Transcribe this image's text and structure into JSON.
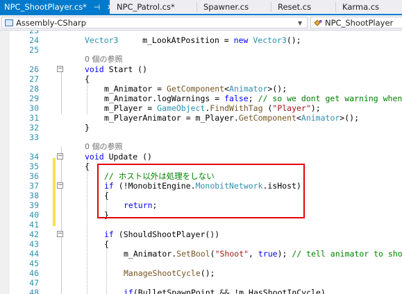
{
  "tabs": [
    {
      "label": "NPC_ShootPlayer.cs*",
      "active": true,
      "pin": "⊣",
      "close": "✕"
    },
    {
      "label": "NPC_Patrol.cs*",
      "active": false
    },
    {
      "label": "Spawner.cs",
      "active": false
    },
    {
      "label": "Reset.cs",
      "active": false
    },
    {
      "label": "Karma.cs",
      "active": false
    }
  ],
  "navbar": {
    "project": "Assembly-CSharp",
    "class": "NPC_ShootPlayer"
  },
  "colors": {
    "accent": "#007acc",
    "keyword": "#0000ff",
    "type": "#2b91af",
    "string": "#a31515",
    "comment": "#008000",
    "method": "#74531f",
    "highlight_box": "#e60000",
    "change_marker": "#f2e24a"
  },
  "icons": [
    "pin-icon",
    "close-icon",
    "project-icon",
    "class-icon",
    "chevron-down-icon",
    "fold-collapse-icon"
  ],
  "lines": [
    {
      "num": "23",
      "indent": 0,
      "fold": false,
      "segs": [
        {
          "t": ""
        }
      ]
    },
    {
      "num": "24",
      "indent": 0,
      "fold": false,
      "segs": [
        {
          "t": "Vector3",
          "c": "t"
        },
        {
          "t": "     m_LookAtPosition = "
        },
        {
          "t": "new",
          "c": "k"
        },
        {
          "t": " "
        },
        {
          "t": "Vector3",
          "c": "t"
        },
        {
          "t": "();"
        }
      ]
    },
    {
      "num": "25",
      "indent": 0,
      "fold": false,
      "segs": [
        {
          "t": ""
        }
      ]
    },
    {
      "num": "",
      "indent": 0,
      "fold": false,
      "ref": true,
      "segs": [
        {
          "t": "0 個の参照"
        }
      ]
    },
    {
      "num": "26",
      "indent": 0,
      "fold": true,
      "segs": [
        {
          "t": "void",
          "c": "k"
        },
        {
          "t": " Start ()"
        }
      ]
    },
    {
      "num": "27",
      "indent": 0,
      "fold": false,
      "segs": [
        {
          "t": "{"
        }
      ]
    },
    {
      "num": "28",
      "indent": 4,
      "fold": false,
      "segs": [
        {
          "t": "m_Animator = "
        },
        {
          "t": "GetComponent",
          "c": "m"
        },
        {
          "t": "<"
        },
        {
          "t": "Animator",
          "c": "t"
        },
        {
          "t": ">();"
        }
      ]
    },
    {
      "num": "29",
      "indent": 4,
      "fold": false,
      "segs": [
        {
          "t": "m_Animator.logWarnings = "
        },
        {
          "t": "false",
          "c": "k"
        },
        {
          "t": "; "
        },
        {
          "t": "// so we dont get warning when",
          "c": "c"
        }
      ]
    },
    {
      "num": "30",
      "indent": 4,
      "fold": false,
      "segs": [
        {
          "t": "m_Player = "
        },
        {
          "t": "GameObject",
          "c": "t"
        },
        {
          "t": "."
        },
        {
          "t": "FindWithTag",
          "c": "m"
        },
        {
          "t": " ("
        },
        {
          "t": "\"Player\"",
          "c": "s"
        },
        {
          "t": ");"
        }
      ]
    },
    {
      "num": "31",
      "indent": 4,
      "fold": false,
      "segs": [
        {
          "t": "m_PlayerAnimator = m_Player."
        },
        {
          "t": "GetComponent",
          "c": "m"
        },
        {
          "t": "<"
        },
        {
          "t": "Animator",
          "c": "t"
        },
        {
          "t": ">();"
        }
      ]
    },
    {
      "num": "32",
      "indent": 0,
      "fold": false,
      "segs": [
        {
          "t": "}"
        }
      ]
    },
    {
      "num": "33",
      "indent": 0,
      "fold": false,
      "segs": [
        {
          "t": ""
        }
      ]
    },
    {
      "num": "",
      "indent": 0,
      "fold": false,
      "ref": true,
      "segs": [
        {
          "t": "0 個の参照"
        }
      ]
    },
    {
      "num": "34",
      "indent": 0,
      "fold": true,
      "segs": [
        {
          "t": "void",
          "c": "k"
        },
        {
          "t": " Update ()"
        }
      ]
    },
    {
      "num": "35",
      "indent": 0,
      "fold": false,
      "segs": [
        {
          "t": "{"
        }
      ]
    },
    {
      "num": "36",
      "indent": 4,
      "fold": false,
      "changed": true,
      "segs": [
        {
          "t": "// ホスト以外は処理をしない",
          "c": "c"
        }
      ]
    },
    {
      "num": "37",
      "indent": 4,
      "fold": true,
      "changed": true,
      "segs": [
        {
          "t": "if",
          "c": "k"
        },
        {
          "t": " (!MonobitEngine."
        },
        {
          "t": "MonobitNetwork",
          "c": "t"
        },
        {
          "t": ".isHost)"
        }
      ]
    },
    {
      "num": "38",
      "indent": 4,
      "fold": false,
      "changed": true,
      "segs": [
        {
          "t": "{"
        }
      ]
    },
    {
      "num": "39",
      "indent": 8,
      "fold": false,
      "changed": true,
      "segs": [
        {
          "t": "return",
          "c": "k"
        },
        {
          "t": ";"
        }
      ]
    },
    {
      "num": "40",
      "indent": 4,
      "fold": false,
      "changed": true,
      "segs": [
        {
          "t": "}"
        }
      ]
    },
    {
      "num": "41",
      "indent": 0,
      "fold": false,
      "changed": true,
      "segs": [
        {
          "t": ""
        }
      ]
    },
    {
      "num": "42",
      "indent": 4,
      "fold": true,
      "changed": true,
      "segs": [
        {
          "t": "if",
          "c": "k"
        },
        {
          "t": " (ShouldShootPlayer())"
        }
      ]
    },
    {
      "num": "43",
      "indent": 4,
      "fold": false,
      "segs": [
        {
          "t": "{"
        }
      ]
    },
    {
      "num": "44",
      "indent": 8,
      "fold": false,
      "segs": [
        {
          "t": "m_Animator."
        },
        {
          "t": "SetBool",
          "c": "m"
        },
        {
          "t": "("
        },
        {
          "t": "\"Shoot\"",
          "c": "s"
        },
        {
          "t": ", "
        },
        {
          "t": "true",
          "c": "k"
        },
        {
          "t": "); "
        },
        {
          "t": "// tell animator to sho",
          "c": "c"
        }
      ]
    },
    {
      "num": "45",
      "indent": 0,
      "fold": false,
      "segs": [
        {
          "t": ""
        }
      ]
    },
    {
      "num": "46",
      "indent": 8,
      "fold": false,
      "segs": [
        {
          "t": "ManageShootCycle",
          "c": "m"
        },
        {
          "t": "();"
        }
      ]
    },
    {
      "num": "47",
      "indent": 0,
      "fold": false,
      "segs": [
        {
          "t": ""
        }
      ]
    },
    {
      "num": "48",
      "indent": 8,
      "fold": false,
      "segs": [
        {
          "t": "if",
          "c": "k"
        },
        {
          "t": "(BulletSpawnPoint && !m_HasShootInCycle)"
        }
      ]
    }
  ]
}
